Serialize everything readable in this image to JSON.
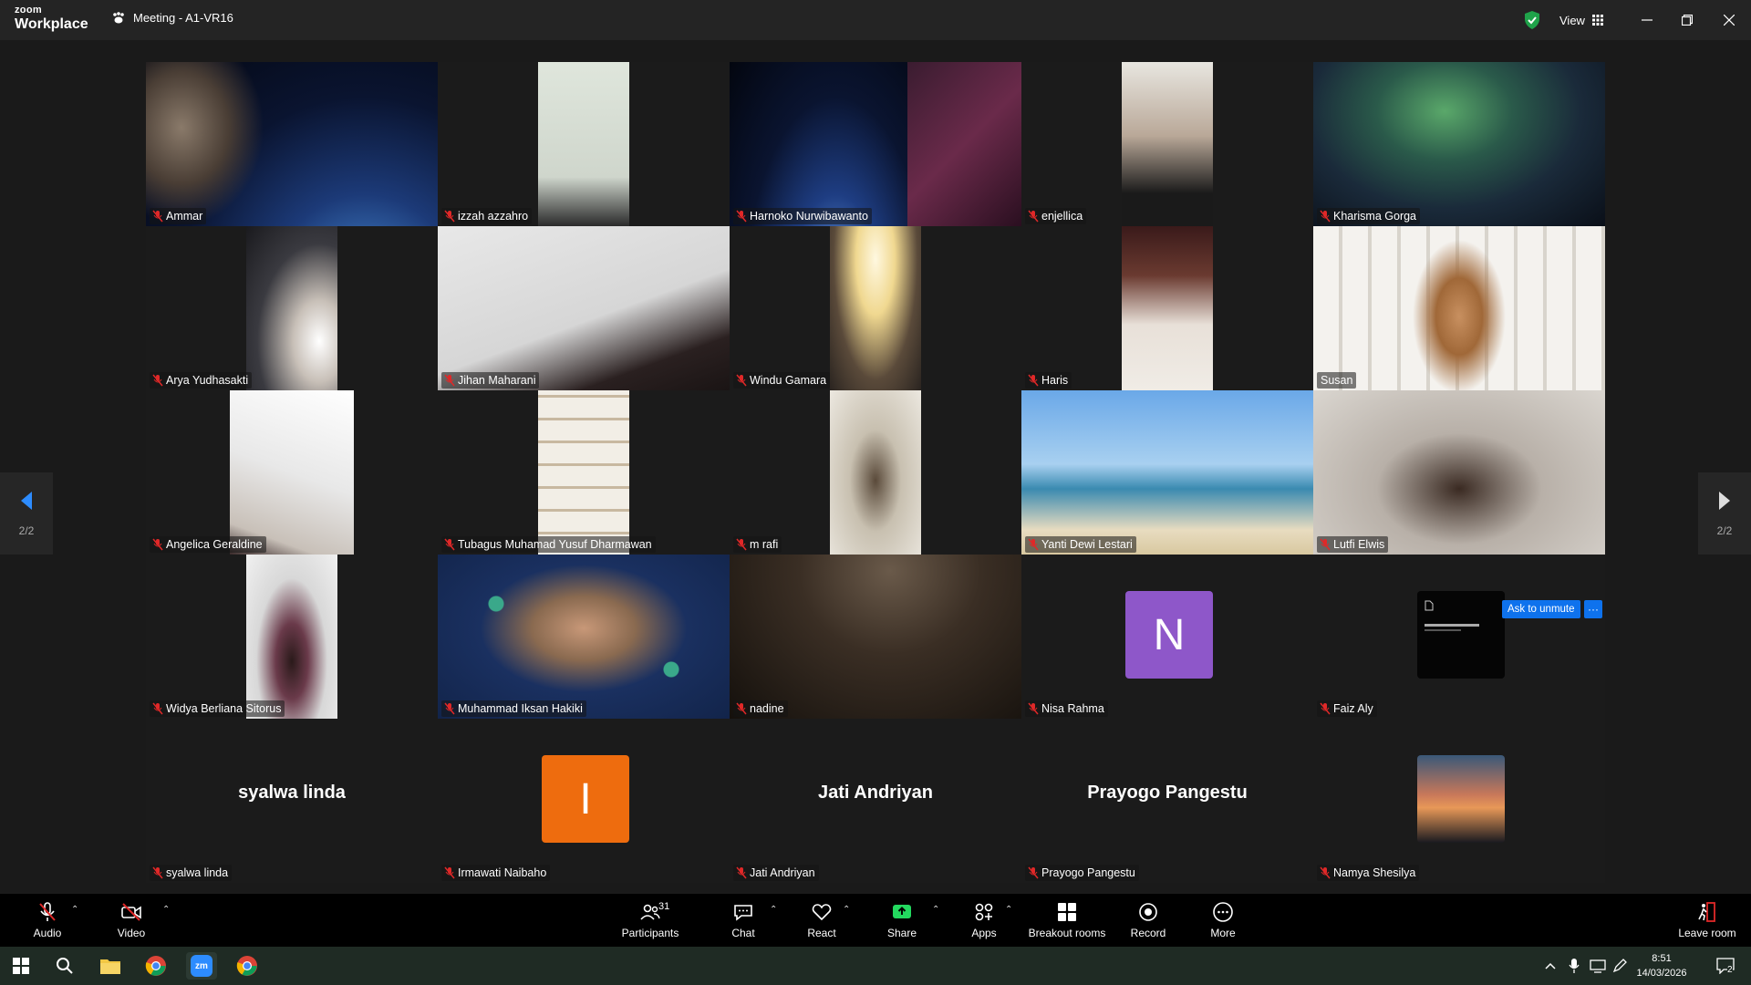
{
  "app": {
    "logo_line1": "zoom",
    "logo_line2": "Workplace",
    "meeting_title": "Meeting - A1-VR16",
    "view_label": "View"
  },
  "pagination": {
    "left": "2/2",
    "right": "2/2"
  },
  "participants": [
    {
      "name": "Ammar"
    },
    {
      "name": "izzah azzahro"
    },
    {
      "name": "Harnoko Nurwibawanto"
    },
    {
      "name": "enjellica"
    },
    {
      "name": "Kharisma Gorga"
    },
    {
      "name": "Arya Yudhasakti"
    },
    {
      "name": "Jihan Maharani"
    },
    {
      "name": "Windu Gamara"
    },
    {
      "name": "Haris"
    },
    {
      "name": "Susan"
    },
    {
      "name": "Angelica Geraldine"
    },
    {
      "name": "Tubagus Muhamad Yusuf Dharmawan"
    },
    {
      "name": "m rafi"
    },
    {
      "name": "Yanti Dewi Lestari"
    },
    {
      "name": "Lutfi Elwis"
    },
    {
      "name": "Widya Berliana Sitorus"
    },
    {
      "name": "Muhammad Iksan Hakiki"
    },
    {
      "name": "nadine"
    },
    {
      "name": "Nisa Rahma",
      "avatar": "N",
      "avatar_color": "#8e57c9"
    },
    {
      "name": "Faiz Aly"
    },
    {
      "name": "syalwa linda",
      "display": "syalwa linda"
    },
    {
      "name": "Irmawati Naibaho",
      "avatar": "I",
      "avatar_color": "#ee6c0e"
    },
    {
      "name": "Jati Andriyan",
      "display": "Jati Andriyan"
    },
    {
      "name": "Prayogo Pangestu",
      "display": "Prayogo Pangestu"
    },
    {
      "name": "Namya Shesilya"
    }
  ],
  "ask_to_unmute": "Ask to unmute",
  "more_dots": "···",
  "toolbar": {
    "audio": "Audio",
    "video": "Video",
    "participants": "Participants",
    "participants_count": "31",
    "chat": "Chat",
    "react": "React",
    "share": "Share",
    "apps": "Apps",
    "breakout": "Breakout rooms",
    "record": "Record",
    "more": "More",
    "leave": "Leave room"
  },
  "taskbar": {
    "time": "8:51",
    "date": "14/03/2026",
    "notif_count": "2",
    "zoom_icon_text": "zm"
  },
  "colors": {
    "active_speaker": "#32d87d",
    "accent_blue": "#0e72ed",
    "share_green": "#23d95f",
    "muted_red": "#e02828"
  }
}
